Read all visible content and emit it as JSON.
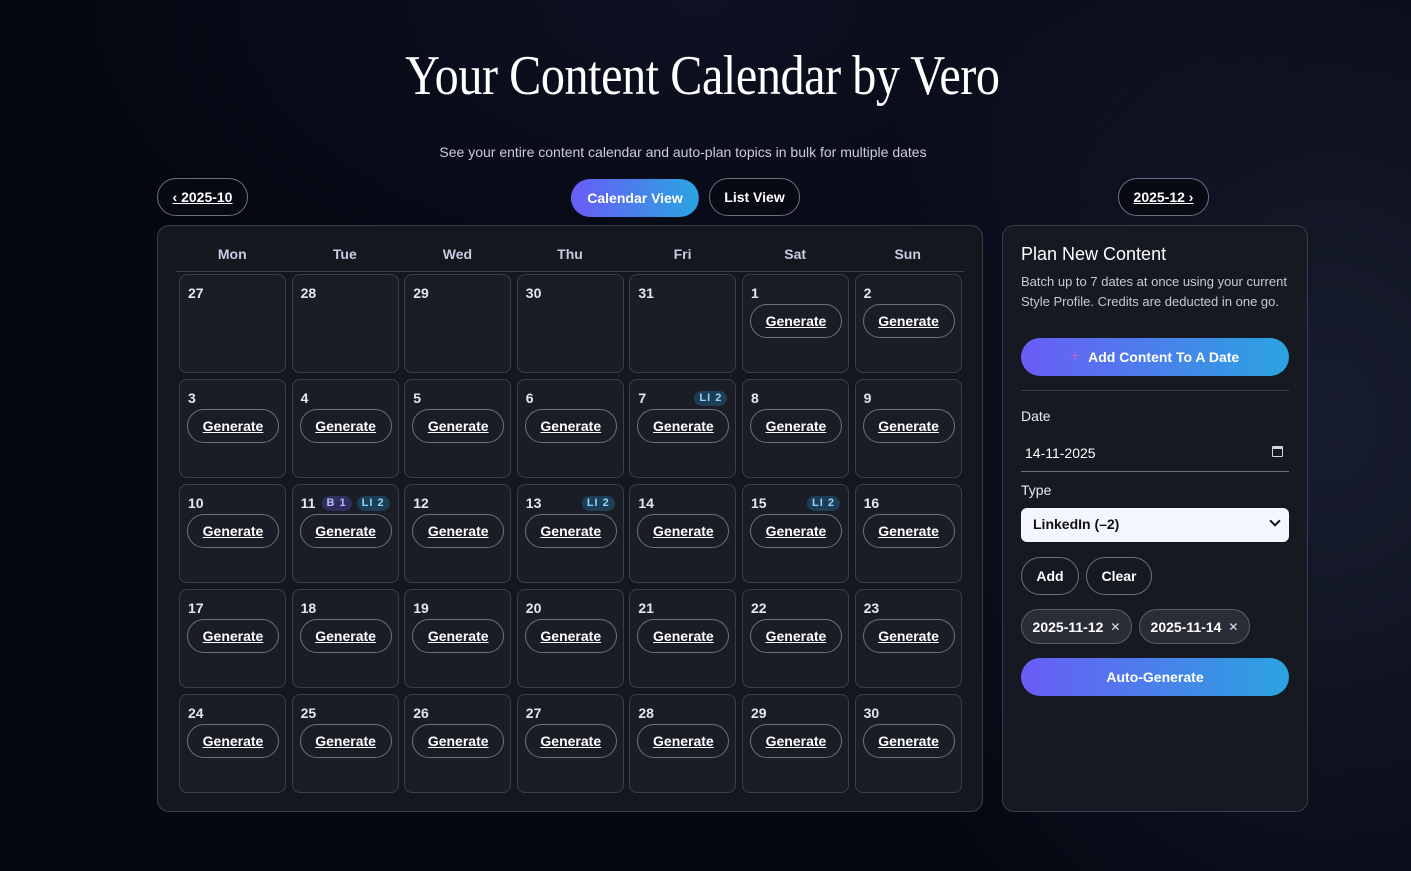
{
  "page": {
    "title": "Your Content Calendar by Vero",
    "subtitle": "See your entire content calendar and auto-plan topics in bulk for multiple dates"
  },
  "nav": {
    "prev_month": "‹ 2025-10",
    "next_month": "2025-12 ›",
    "calendar_view": "Calendar View",
    "list_view": "List View",
    "active_view": "calendar"
  },
  "calendar": {
    "weekdays": [
      "Mon",
      "Tue",
      "Wed",
      "Thu",
      "Fri",
      "Sat",
      "Sun"
    ],
    "generate_label": "Generate",
    "weeks": [
      [
        {
          "day": "27",
          "generate": false,
          "badges": []
        },
        {
          "day": "28",
          "generate": false,
          "badges": []
        },
        {
          "day": "29",
          "generate": false,
          "badges": []
        },
        {
          "day": "30",
          "generate": false,
          "badges": []
        },
        {
          "day": "31",
          "generate": false,
          "badges": []
        },
        {
          "day": "1",
          "generate": true,
          "badges": []
        },
        {
          "day": "2",
          "generate": true,
          "badges": []
        }
      ],
      [
        {
          "day": "3",
          "generate": true,
          "badges": []
        },
        {
          "day": "4",
          "generate": true,
          "badges": []
        },
        {
          "day": "5",
          "generate": true,
          "badges": []
        },
        {
          "day": "6",
          "generate": true,
          "badges": []
        },
        {
          "day": "7",
          "generate": true,
          "badges": [
            {
              "type": "li",
              "text": "LI 2"
            }
          ]
        },
        {
          "day": "8",
          "generate": true,
          "badges": []
        },
        {
          "day": "9",
          "generate": true,
          "badges": []
        }
      ],
      [
        {
          "day": "10",
          "generate": true,
          "badges": []
        },
        {
          "day": "11",
          "generate": true,
          "badges": [
            {
              "type": "b",
              "text": "B 1"
            },
            {
              "type": "li",
              "text": "LI 2"
            }
          ]
        },
        {
          "day": "12",
          "generate": true,
          "badges": []
        },
        {
          "day": "13",
          "generate": true,
          "badges": [
            {
              "type": "li",
              "text": "LI 2"
            }
          ]
        },
        {
          "day": "14",
          "generate": true,
          "badges": []
        },
        {
          "day": "15",
          "generate": true,
          "badges": [
            {
              "type": "li",
              "text": "LI 2"
            }
          ]
        },
        {
          "day": "16",
          "generate": true,
          "badges": []
        }
      ],
      [
        {
          "day": "17",
          "generate": true,
          "badges": []
        },
        {
          "day": "18",
          "generate": true,
          "badges": []
        },
        {
          "day": "19",
          "generate": true,
          "badges": []
        },
        {
          "day": "20",
          "generate": true,
          "badges": []
        },
        {
          "day": "21",
          "generate": true,
          "badges": []
        },
        {
          "day": "22",
          "generate": true,
          "badges": []
        },
        {
          "day": "23",
          "generate": true,
          "badges": []
        }
      ],
      [
        {
          "day": "24",
          "generate": true,
          "badges": []
        },
        {
          "day": "25",
          "generate": true,
          "badges": []
        },
        {
          "day": "26",
          "generate": true,
          "badges": []
        },
        {
          "day": "27",
          "generate": true,
          "badges": []
        },
        {
          "day": "28",
          "generate": true,
          "badges": []
        },
        {
          "day": "29",
          "generate": true,
          "badges": []
        },
        {
          "day": "30",
          "generate": true,
          "badges": []
        }
      ]
    ]
  },
  "sidebar": {
    "heading": "Plan New Content",
    "description": "Batch up to 7 dates at once using your current Style Profile. Credits are deducted in one go.",
    "add_content_label": "Add Content To A Date",
    "date_label": "Date",
    "date_value": "14-11-2025",
    "type_label": "Type",
    "type_value": "LinkedIn (–2)",
    "add_label": "Add",
    "clear_label": "Clear",
    "selected_dates": [
      "2025-11-12",
      "2025-11-14"
    ],
    "auto_generate_label": "Auto-Generate"
  },
  "colors": {
    "accent_start": "#6a5cf6",
    "accent_end": "#2aa4e0",
    "background": "#050712"
  }
}
